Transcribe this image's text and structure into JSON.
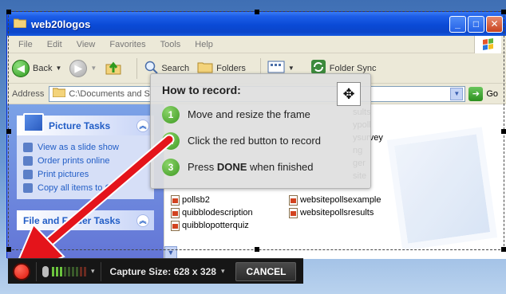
{
  "window": {
    "title": "web20logos",
    "minimize": "_",
    "maximize": "□",
    "close": "✕"
  },
  "menu": [
    "File",
    "Edit",
    "View",
    "Favorites",
    "Tools",
    "Help"
  ],
  "toolbar": {
    "back": "Back",
    "search": "Search",
    "folders": "Folders",
    "folder_sync": "Folder Sync"
  },
  "address": {
    "label": "Address",
    "value": "C:\\Documents and S",
    "go": "Go"
  },
  "taskpane": {
    "picture_tasks": {
      "title": "Picture Tasks",
      "items": [
        "View as a slide show",
        "Order prints online",
        "Print pictures",
        "Copy all items to CD"
      ]
    },
    "file_folder_tasks": {
      "title": "File and Folder Tasks"
    }
  },
  "files": {
    "left": [
      "pollsb2",
      "quibblodescription",
      "quibblopotterquiz"
    ],
    "right_partial": [
      "sults",
      "ypoll",
      "ysurvey",
      "ng",
      "ger",
      "site"
    ],
    "right": [
      "websitepollsexample",
      "websitepollsresults"
    ]
  },
  "howto": {
    "title": "How to record:",
    "steps": [
      {
        "num": "1",
        "pre": "Move and resize the frame",
        "bold": "",
        "post": ""
      },
      {
        "num": "2",
        "pre": "Click the red button to record",
        "bold": "",
        "post": ""
      },
      {
        "num": "3",
        "pre": "Press ",
        "bold": "DONE",
        "post": " when finished"
      }
    ]
  },
  "capture": {
    "size_label": "Capture Size: 628 x 328",
    "cancel": "CANCEL",
    "dropdown": "▾"
  },
  "colors": {
    "record_red": "#e0160a",
    "arrow_red": "#e4141b",
    "xp_blue": "#0a4ad6",
    "step_green": "#3e9a22"
  }
}
